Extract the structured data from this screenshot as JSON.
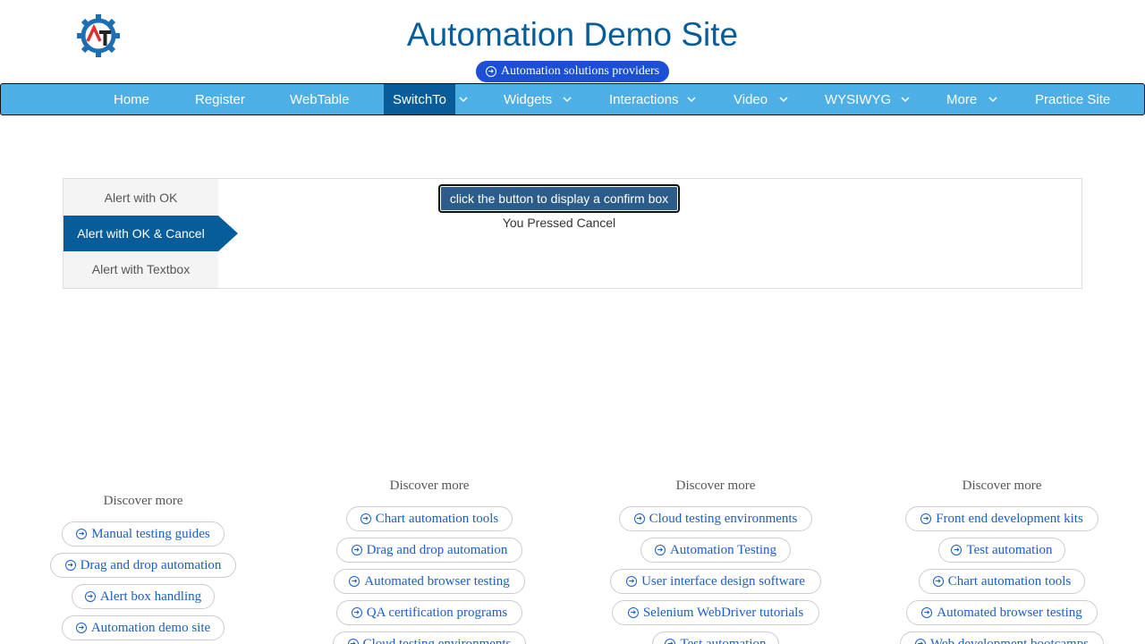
{
  "header": {
    "title": "Automation Demo Site",
    "ad_pill": "Automation solutions providers",
    "logo_icon": "gear-logo-icon"
  },
  "nav": {
    "items": [
      {
        "label": "Home"
      },
      {
        "label": "Register"
      },
      {
        "label": "WebTable"
      },
      {
        "label": "SwitchTo",
        "active": true,
        "dropdown": true
      },
      {
        "label": "Widgets",
        "dropdown": true
      },
      {
        "label": "Interactions",
        "dropdown": true
      },
      {
        "label": "Video",
        "dropdown": true
      },
      {
        "label": "WYSIWYG",
        "dropdown": true
      },
      {
        "label": "More",
        "dropdown": true
      },
      {
        "label": "Practice Site"
      }
    ]
  },
  "tabs": [
    {
      "label": "Alert with OK"
    },
    {
      "label": "Alert with OK & Cancel",
      "active": true
    },
    {
      "label": "Alert with Textbox"
    }
  ],
  "main": {
    "button_label": "click the button to display a confirm box",
    "result_text": "You Pressed Cancel"
  },
  "discover": [
    {
      "heading": "Discover more",
      "links": [
        "Manual testing guides",
        "Drag and drop automation",
        "Alert box handling",
        "Automation demo site"
      ]
    },
    {
      "heading": "Discover more",
      "links": [
        "Chart automation tools",
        "Drag and drop automation",
        "Automated browser testing",
        "QA certification programs",
        "Cloud testing environments"
      ]
    },
    {
      "heading": "Discover more",
      "links": [
        "Cloud testing environments",
        "Automation Testing",
        "User interface design software",
        "Selenium WebDriver tutorials",
        "Test automation"
      ]
    },
    {
      "heading": "Discover more",
      "links": [
        "Front end development kits",
        "Test automation",
        "Chart automation tools",
        "Automated browser testing",
        "Web development bootcamps"
      ]
    }
  ],
  "colors": {
    "brand": "#065d9a",
    "nav": "#4eaee6",
    "nav_active": "#085c99",
    "link": "#1a5ec8"
  }
}
